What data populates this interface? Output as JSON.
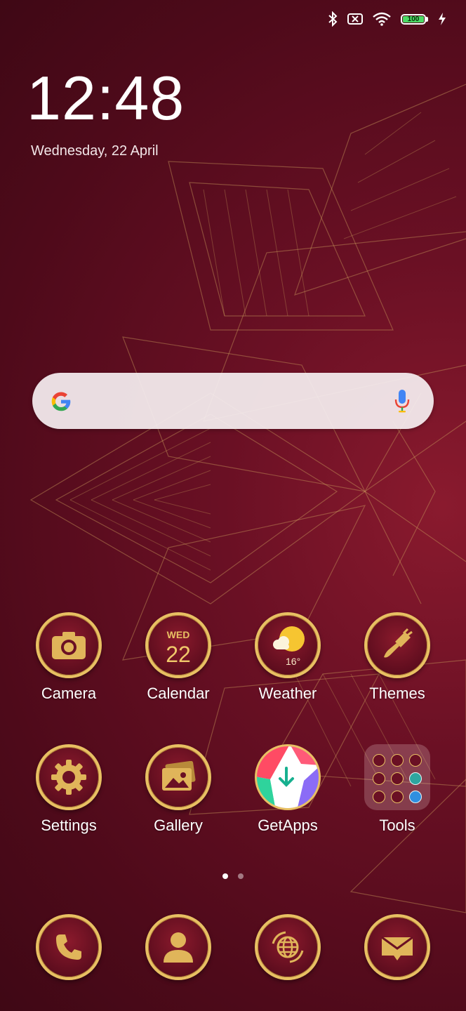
{
  "status_bar": {
    "battery_level": "100",
    "icons": [
      "bluetooth-icon",
      "no-sim-icon",
      "wifi-icon",
      "battery-icon",
      "charging-icon"
    ]
  },
  "clock": {
    "time": "12:48",
    "date": "Wednesday, 22 April"
  },
  "search_widget": {
    "logo": "google-g-icon",
    "mic": "mic-icon"
  },
  "home_apps": [
    {
      "label": "Camera",
      "icon": "camera-icon"
    },
    {
      "label": "Calendar",
      "icon": "calendar-icon",
      "weekday": "WED",
      "day": "22"
    },
    {
      "label": "Weather",
      "icon": "weather-icon",
      "temp": "16°"
    },
    {
      "label": "Themes",
      "icon": "paintbrush-icon"
    },
    {
      "label": "Settings",
      "icon": "gear-icon"
    },
    {
      "label": "Gallery",
      "icon": "gallery-icon"
    },
    {
      "label": "GetApps",
      "icon": "getapps-icon"
    },
    {
      "label": "Tools",
      "icon": "folder-icon"
    }
  ],
  "page_indicator": {
    "pages": 2,
    "current": 1
  },
  "dock": [
    {
      "icon": "phone-icon"
    },
    {
      "icon": "contacts-icon"
    },
    {
      "icon": "browser-icon"
    },
    {
      "icon": "messages-icon"
    }
  ],
  "colors": {
    "accent_gold": "#e8c063",
    "background": "#5e0d1e"
  }
}
